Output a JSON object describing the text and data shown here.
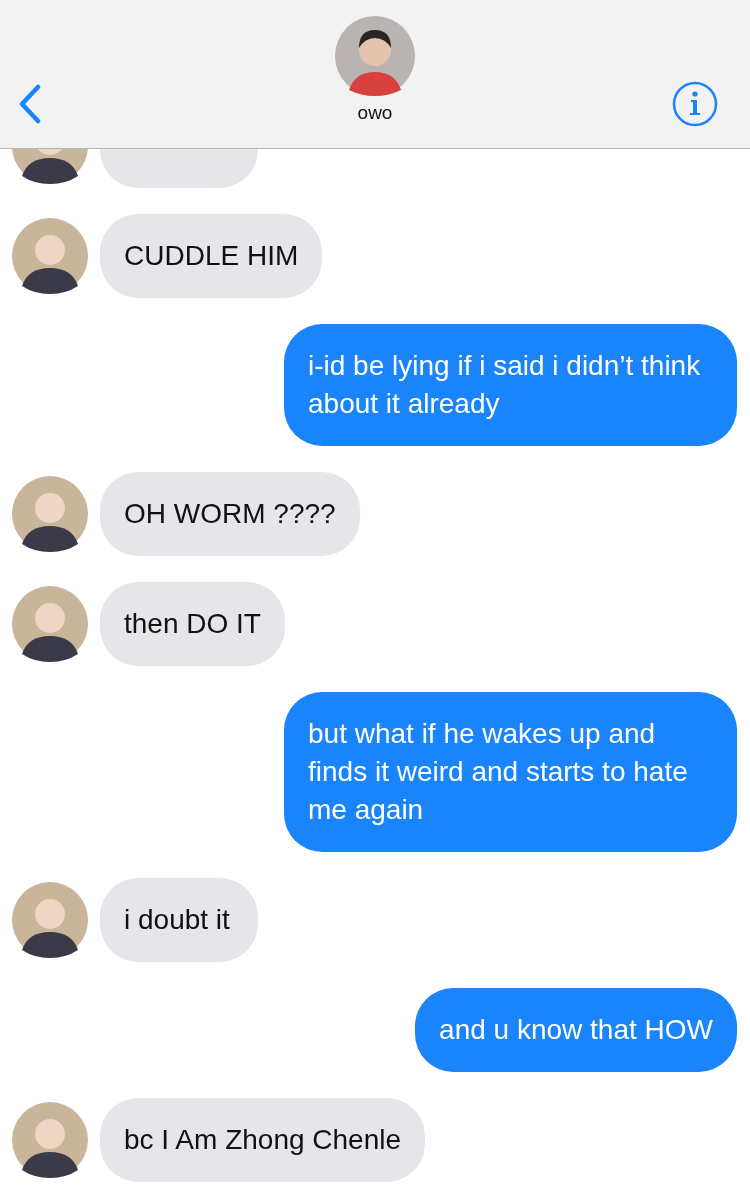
{
  "header": {
    "contact_name": "owo"
  },
  "messages": [
    {
      "kind": "incoming"
    },
    {
      "kind": "incoming",
      "text": "CUDDLE HIM"
    },
    {
      "kind": "outgoing",
      "text": "i-id be lying if i said i didn’t think about it already"
    },
    {
      "kind": "incoming",
      "text": "OH WORM ????"
    },
    {
      "kind": "incoming",
      "text": "then DO IT"
    },
    {
      "kind": "outgoing",
      "text": "but what if he wakes up and finds it weird and starts to hate me again"
    },
    {
      "kind": "incoming",
      "text": "i doubt it"
    },
    {
      "kind": "outgoing",
      "text": "and u know that HOW"
    },
    {
      "kind": "incoming",
      "text": "bc I Am Zhong Chenle"
    }
  ]
}
